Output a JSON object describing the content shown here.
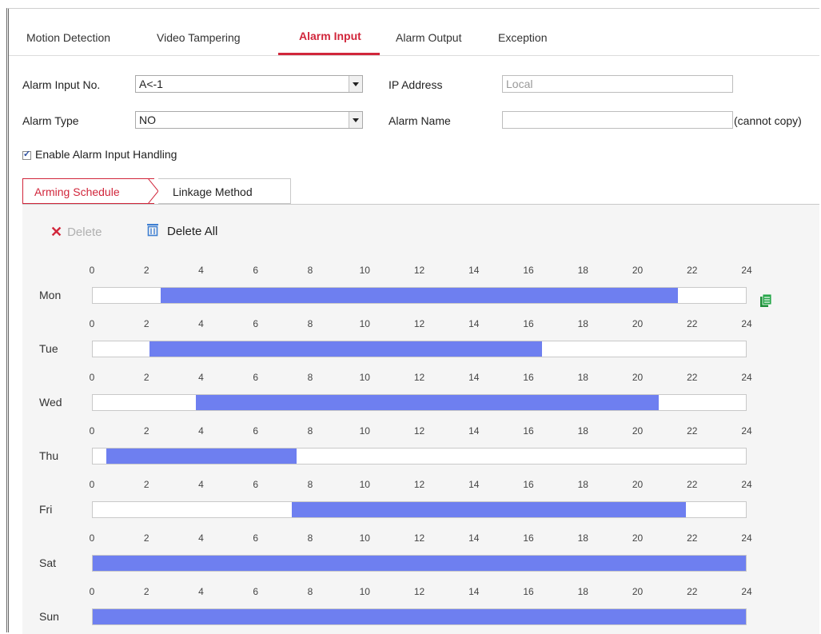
{
  "tabs": [
    {
      "label": "Motion Detection",
      "active": false
    },
    {
      "label": "Video Tampering",
      "active": false
    },
    {
      "label": "Alarm Input",
      "active": true
    },
    {
      "label": "Alarm Output",
      "active": false
    },
    {
      "label": "Exception",
      "active": false
    }
  ],
  "form": {
    "alarm_input_no_label": "Alarm Input No.",
    "alarm_input_no_value": "A<-1",
    "ip_address_label": "IP Address",
    "ip_address_value": "Local",
    "alarm_type_label": "Alarm Type",
    "alarm_type_value": "NO",
    "alarm_name_label": "Alarm Name",
    "alarm_name_value": "",
    "alarm_name_hint": "(cannot copy)",
    "enable_label": "Enable Alarm Input Handling",
    "enable_checked": true
  },
  "subtabs": {
    "arming_schedule": "Arming Schedule",
    "linkage_method": "Linkage Method"
  },
  "toolbar": {
    "delete_label": "Delete",
    "delete_all_label": "Delete All"
  },
  "schedule": {
    "tick_labels": [
      "0",
      "2",
      "4",
      "6",
      "8",
      "10",
      "12",
      "14",
      "16",
      "18",
      "20",
      "22",
      "24"
    ],
    "days": [
      {
        "label": "Mon",
        "segments": [
          [
            2.5,
            21.5
          ]
        ]
      },
      {
        "label": "Tue",
        "segments": [
          [
            2.1,
            16.5
          ]
        ]
      },
      {
        "label": "Wed",
        "segments": [
          [
            3.8,
            20.8
          ]
        ]
      },
      {
        "label": "Thu",
        "segments": [
          [
            0.5,
            7.5
          ]
        ]
      },
      {
        "label": "Fri",
        "segments": [
          [
            7.3,
            21.8
          ]
        ]
      },
      {
        "label": "Sat",
        "segments": [
          [
            0,
            24
          ]
        ]
      },
      {
        "label": "Sun",
        "segments": [
          [
            0,
            24
          ]
        ]
      }
    ],
    "bar_color": "#6e7ff0"
  },
  "colors": {
    "accent": "#d1263b",
    "icon_blue": "#3f7fd1",
    "copy_icon": "#1f8f3a"
  }
}
